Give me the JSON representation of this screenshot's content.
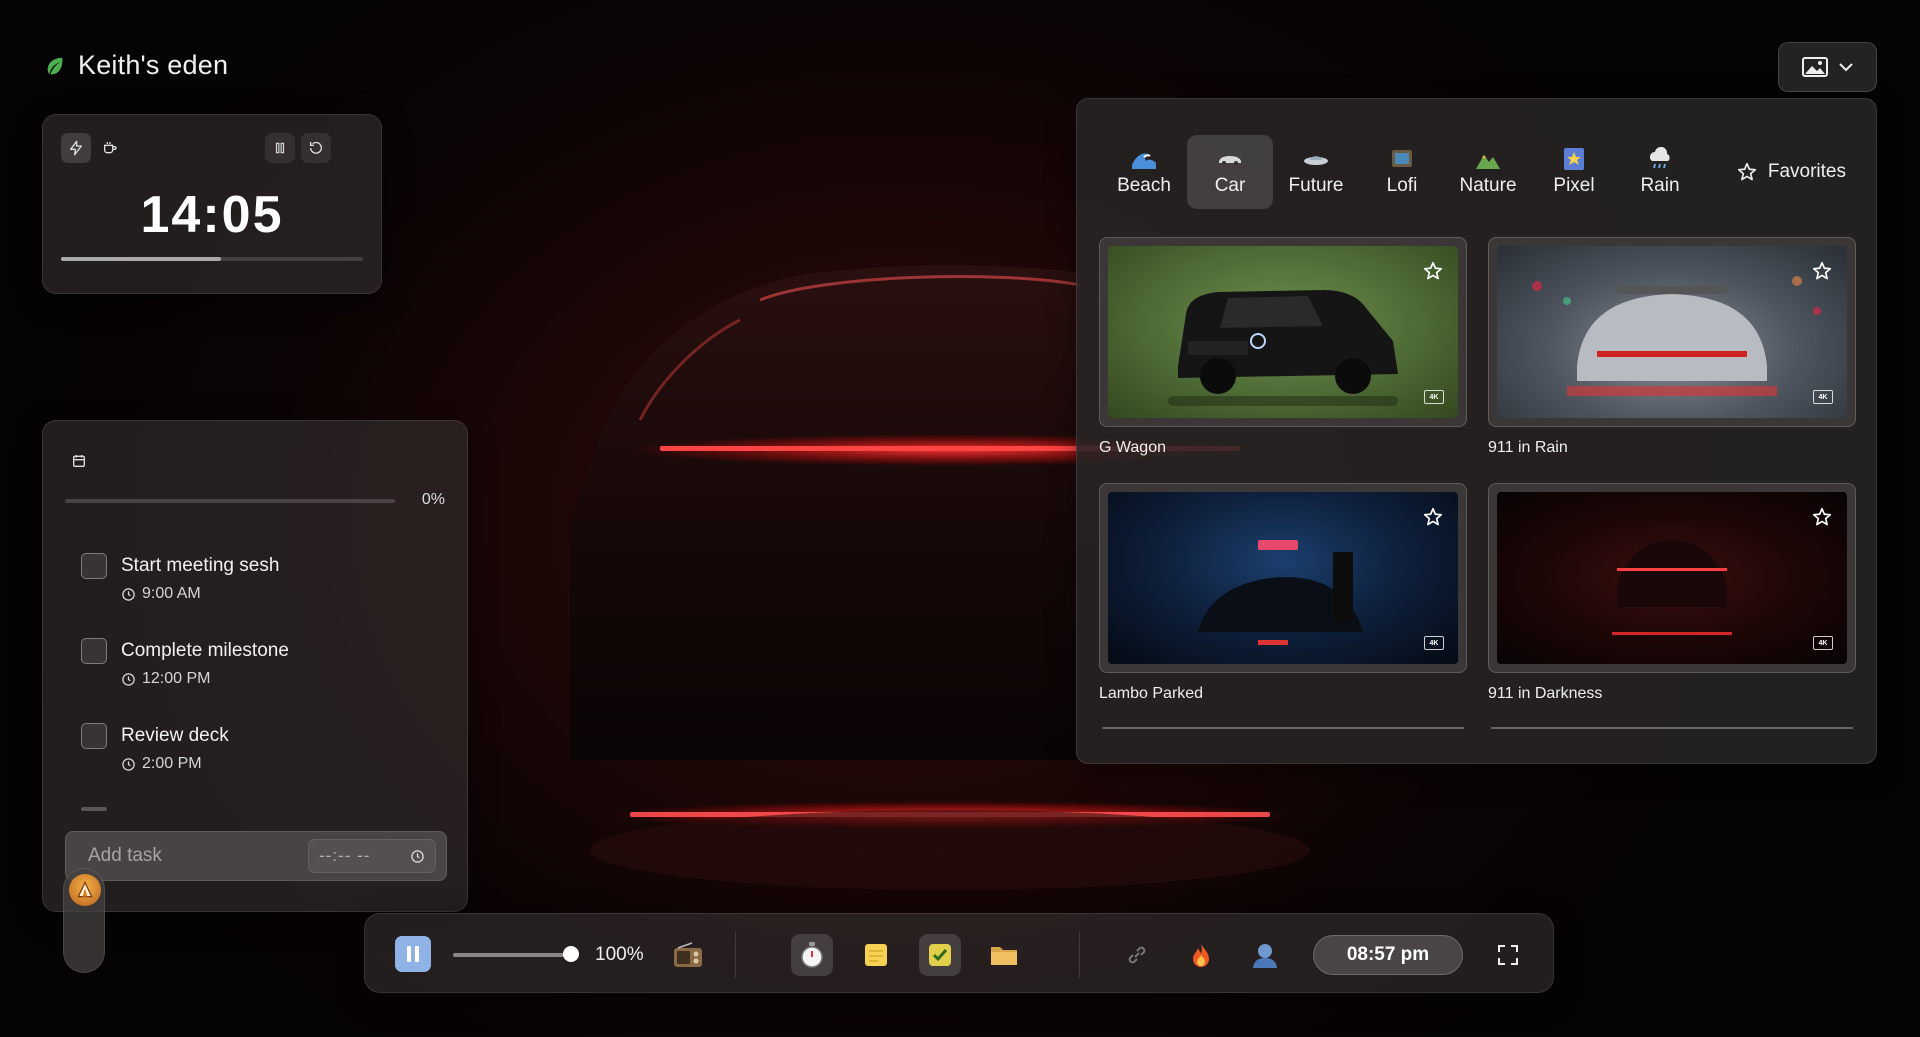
{
  "brand": {
    "title": "Keith's eden",
    "icon": "leaf-icon",
    "icon_color": "#4caf50"
  },
  "timer": {
    "time": "14:05",
    "progress": 0.53,
    "left_icons": [
      "lightning-icon",
      "coffee-cup-icon"
    ],
    "right_icons": [
      "pause-icon",
      "reset-icon"
    ]
  },
  "tasks": {
    "progress_label": "0%",
    "progress": 0,
    "items": [
      {
        "title": "Start meeting sesh",
        "time": "9:00 AM"
      },
      {
        "title": "Complete milestone",
        "time": "12:00 PM"
      },
      {
        "title": "Review deck",
        "time": "2:00 PM"
      }
    ],
    "add_placeholder": "Add task",
    "time_placeholder": "--:-- --"
  },
  "toolbar": {
    "volume_label": "100%",
    "volume": 1.0,
    "clock": "08:57 pm",
    "accent": "#8fb3e6"
  },
  "gallery": {
    "categories": [
      {
        "label": "Beach",
        "icon": "wave-icon",
        "active": false
      },
      {
        "label": "Car",
        "icon": "car-icon",
        "active": true
      },
      {
        "label": "Future",
        "icon": "ufo-icon",
        "active": false
      },
      {
        "label": "Lofi",
        "icon": "tv-icon",
        "active": false
      },
      {
        "label": "Nature",
        "icon": "mountain-icon",
        "active": false
      },
      {
        "label": "Pixel",
        "icon": "pixel-star-icon",
        "active": false
      },
      {
        "label": "Rain",
        "icon": "rain-cloud-icon",
        "active": false
      }
    ],
    "favorites_label": "Favorites",
    "cards": [
      {
        "title": "G Wagon",
        "badge": "4K"
      },
      {
        "title": "911 in Rain",
        "badge": "4K"
      },
      {
        "title": "Lambo Parked",
        "badge": "4K"
      },
      {
        "title": "911 in Darkness",
        "badge": "4K"
      }
    ]
  }
}
